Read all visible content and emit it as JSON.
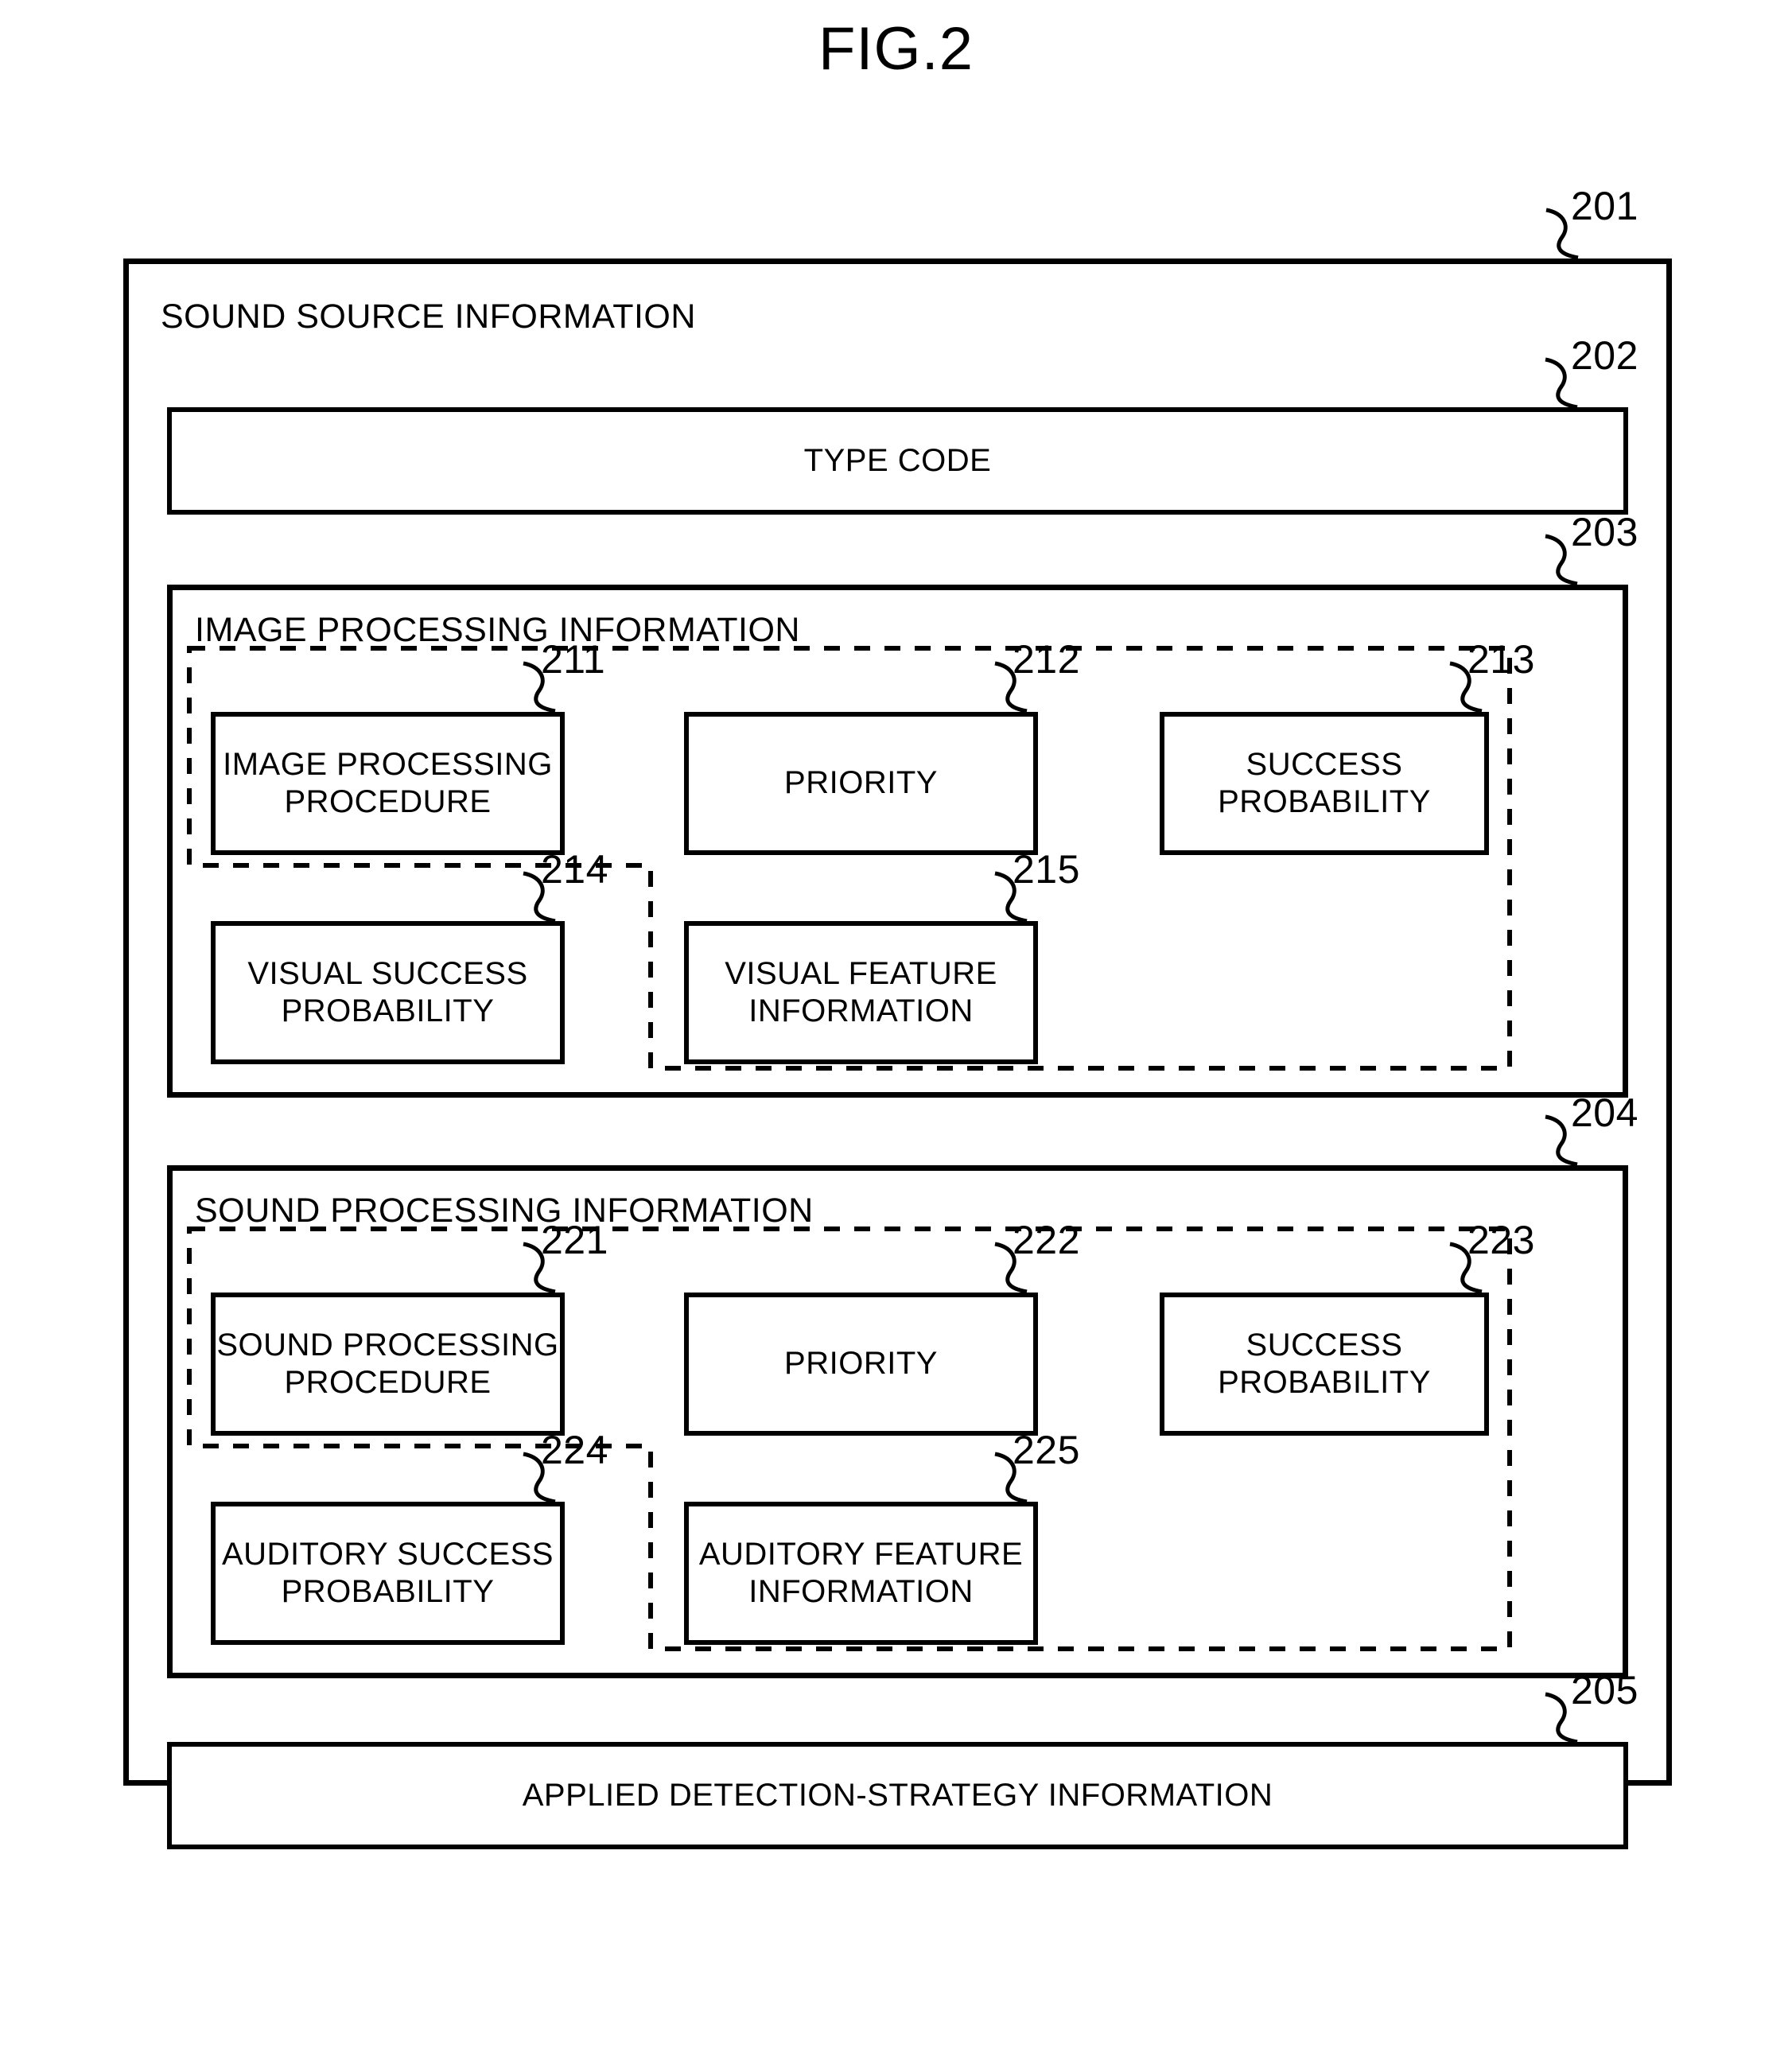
{
  "figure": {
    "title": "FIG.2"
  },
  "outer": {
    "ref": "201",
    "title": "SOUND SOURCE INFORMATION"
  },
  "type_code": {
    "ref": "202",
    "label": "TYPE CODE"
  },
  "image_processing": {
    "ref": "203",
    "title": "IMAGE PROCESSING INFORMATION",
    "items": [
      {
        "ref": "211",
        "label": "IMAGE PROCESSING PROCEDURE"
      },
      {
        "ref": "212",
        "label": "PRIORITY"
      },
      {
        "ref": "213",
        "label": "SUCCESS PROBABILITY"
      },
      {
        "ref": "214",
        "label": "VISUAL SUCCESS PROBABILITY"
      },
      {
        "ref": "215",
        "label": "VISUAL FEATURE INFORMATION"
      }
    ]
  },
  "sound_processing": {
    "ref": "204",
    "title": "SOUND PROCESSING INFORMATION",
    "items": [
      {
        "ref": "221",
        "label": "SOUND PROCESSING PROCEDURE"
      },
      {
        "ref": "222",
        "label": "PRIORITY"
      },
      {
        "ref": "223",
        "label": "SUCCESS PROBABILITY"
      },
      {
        "ref": "224",
        "label": "AUDITORY SUCCESS PROBABILITY"
      },
      {
        "ref": "225",
        "label": "AUDITORY FEATURE INFORMATION"
      }
    ]
  },
  "applied_detection_strategy": {
    "ref": "205",
    "label": "APPLIED DETECTION-STRATEGY INFORMATION"
  },
  "colors": {
    "ink": "#000000",
    "paper": "#ffffff"
  }
}
